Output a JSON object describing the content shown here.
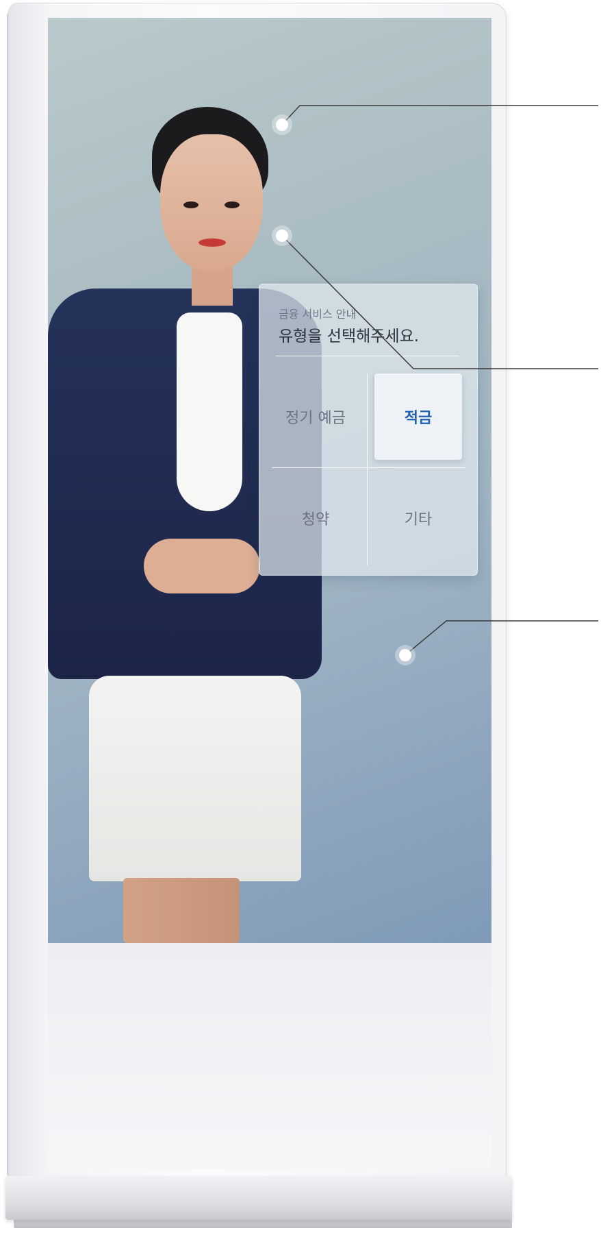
{
  "menu": {
    "subtitle": "금융 서비스 안내",
    "title": "유형을 선택해주세요.",
    "options": [
      {
        "label": "정기 예금",
        "selected": false
      },
      {
        "label": "적금",
        "selected": true
      },
      {
        "label": "청약",
        "selected": false
      },
      {
        "label": "기타",
        "selected": false
      }
    ]
  },
  "colors": {
    "accent": "#1f5fb0",
    "screen_bg": "#9fb3c2",
    "callout_line": "#3a3a3a"
  }
}
